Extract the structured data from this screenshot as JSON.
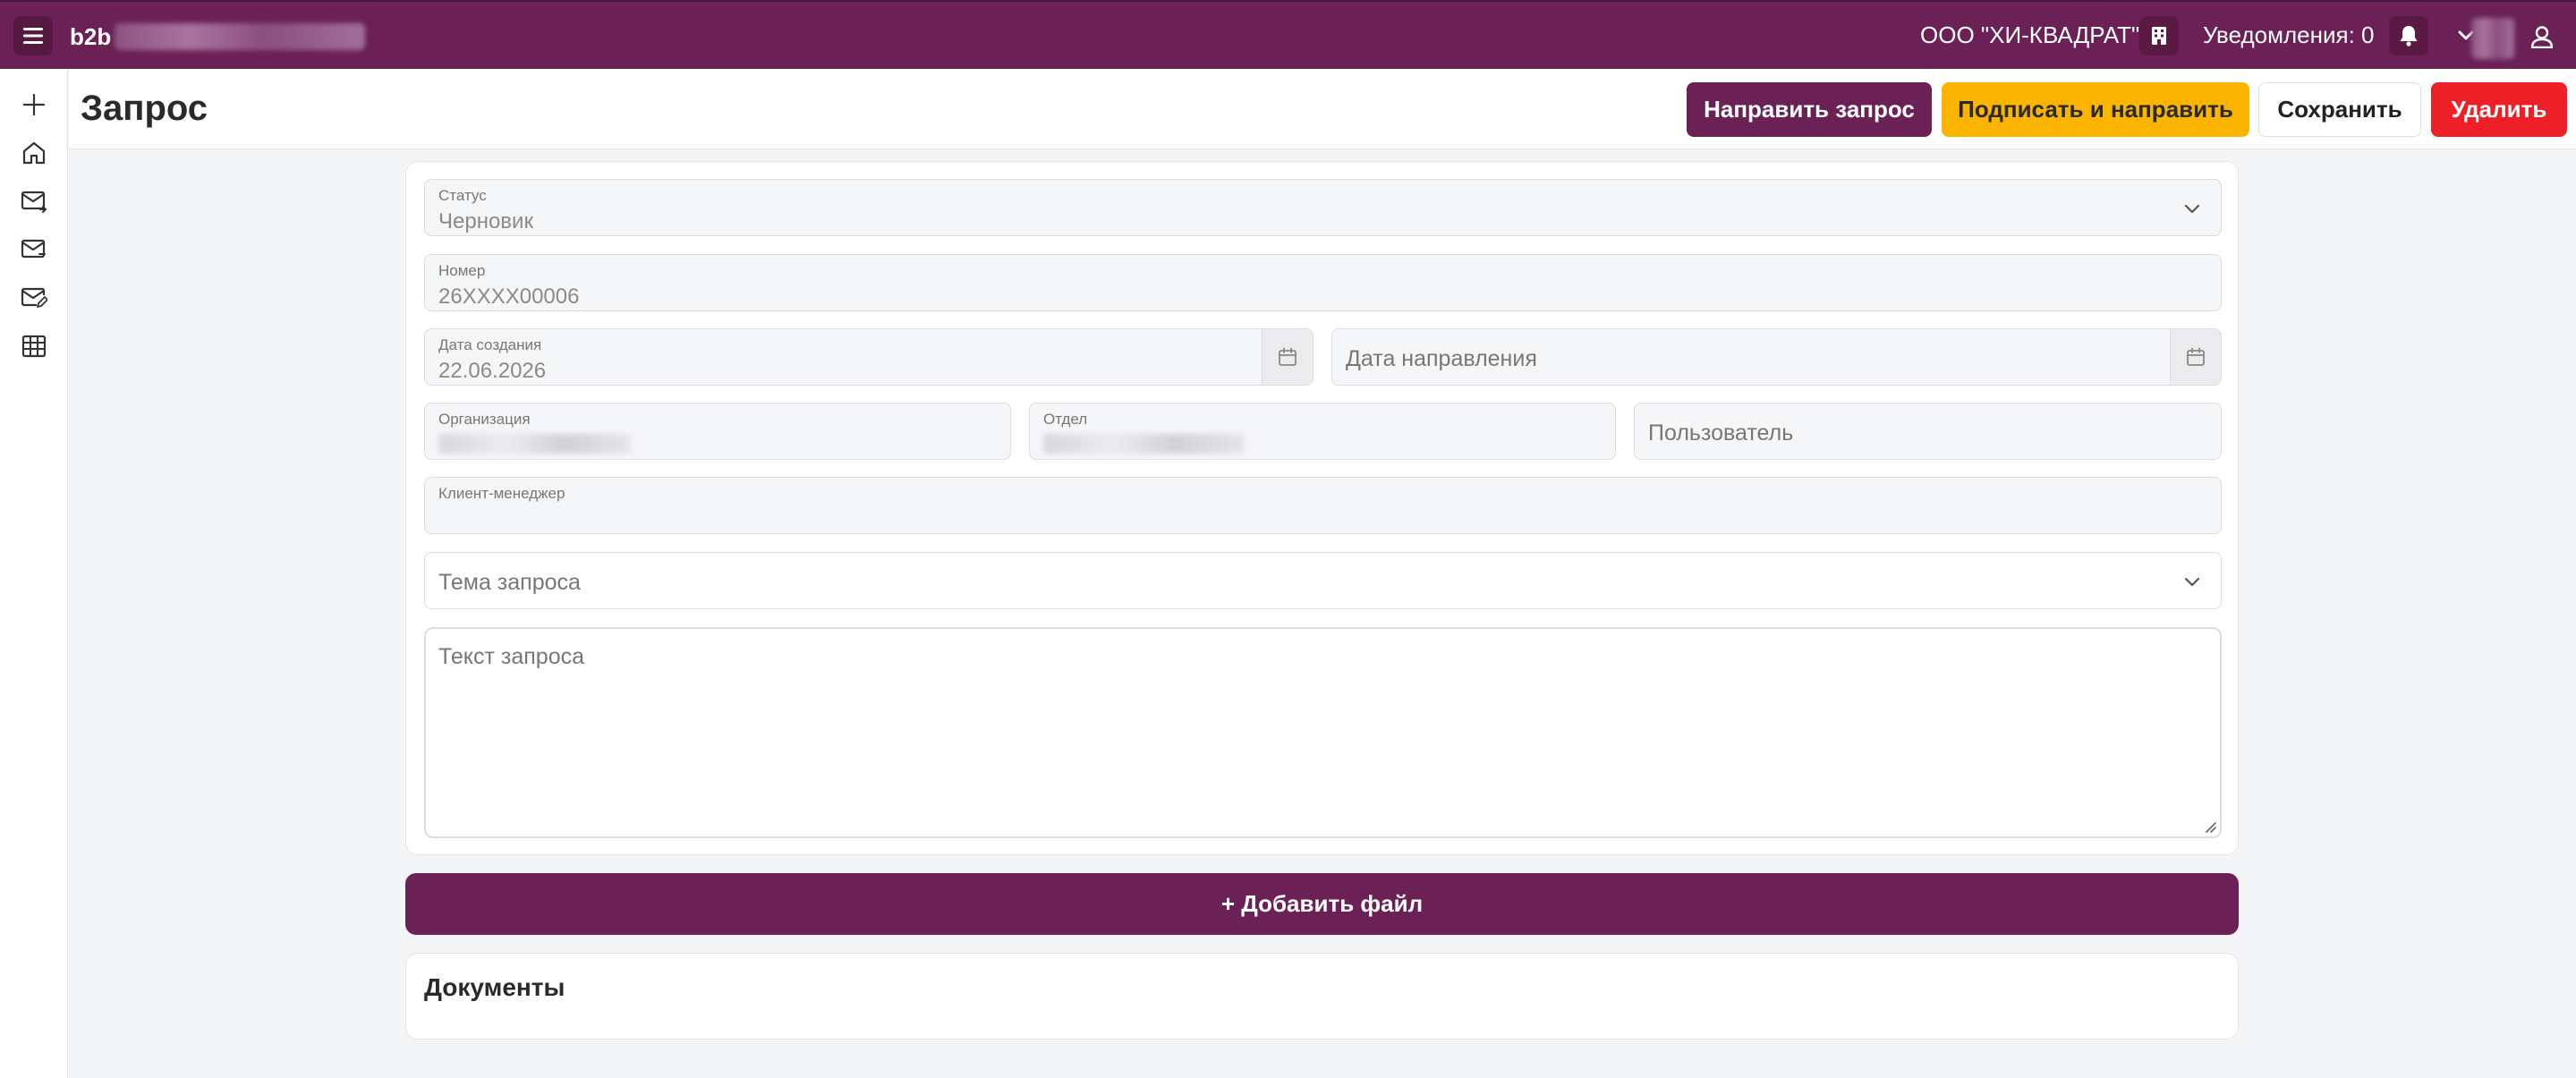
{
  "topbar": {
    "brand": "b2b",
    "org_name": "ООО \"ХИ-КВАДРАТ\"",
    "notifications_label": "Уведомления: 0"
  },
  "sidebar": {
    "items": [
      {
        "icon": "plus-icon"
      },
      {
        "icon": "home-icon"
      },
      {
        "icon": "mail-in-icon"
      },
      {
        "icon": "mail-out-icon"
      },
      {
        "icon": "mail-edit-icon"
      },
      {
        "icon": "table-icon"
      }
    ]
  },
  "header": {
    "title": "Запрос",
    "send_label": "Направить запрос",
    "sign_label": "Подписать и направить",
    "save_label": "Сохранить",
    "delete_label": "Удалить"
  },
  "form": {
    "status_label": "Статус",
    "status_value": "Черновик",
    "number_label": "Номер",
    "number_value": "26XXXX00006",
    "created_label": "Дата создания",
    "created_value": "22.06.2026",
    "sent_placeholder": "Дата направления",
    "organization_label": "Организация",
    "department_label": "Отдел",
    "user_placeholder": "Пользователь",
    "manager_label": "Клиент-менеджер",
    "topic_placeholder": "Тема запроса",
    "text_placeholder": "Текст запроса"
  },
  "add_file_label": "+ Добавить файл",
  "documents_title": "Документы",
  "colors": {
    "primary": "#6b2155",
    "warning": "#fbb500",
    "danger": "#ee2027"
  }
}
